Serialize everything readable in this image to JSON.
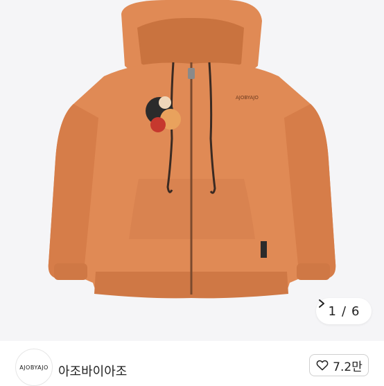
{
  "gallery": {
    "current": "1",
    "separator": "/",
    "total": "6",
    "next_icon": "chevron-right-icon",
    "product_colors": {
      "knit": "#e08a55",
      "knit_shadow": "#c86f3c",
      "knit_light": "#ee9e69",
      "drawstring": "#3a2a22"
    }
  },
  "product": {
    "chest_logo": "AJOBYAJO",
    "side_logo": "AJOBYAJO"
  },
  "shop": {
    "avatar_text": "AJOBYAJO",
    "name": "아조바이아조",
    "like_icon": "heart-outline-icon",
    "like_count": "7.2만"
  }
}
